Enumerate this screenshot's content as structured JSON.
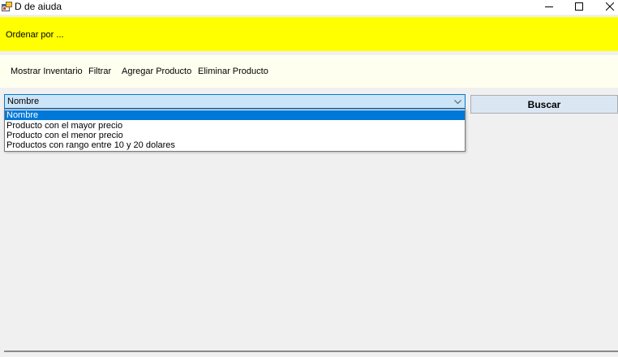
{
  "window": {
    "title": "D de aiuda",
    "icons": {
      "app": "app-window-icon",
      "minimize": "minimize-icon",
      "maximize": "maximize-icon",
      "close": "close-icon"
    }
  },
  "order_bar": {
    "label": "Ordenar por ..."
  },
  "menu": {
    "items": [
      "Mostrar Inventario",
      "Filtrar",
      "Agregar Producto",
      "Eliminar Producto"
    ]
  },
  "sort_combo": {
    "selected": "Nombre",
    "arrow_icon": "chevron-down-icon",
    "options": [
      "Nombre",
      "Producto con el mayor precio",
      "Producto con el menor precio",
      "Productos con rango entre 10 y 20 dolares"
    ],
    "highlighted_index": 0
  },
  "search_button": {
    "label": "Buscar"
  },
  "colors": {
    "order_bar": "#ffff00",
    "menu_bar": "#fffff0",
    "selection": "#0078d7",
    "combo_background": "#cce4f7",
    "button_background": "#dbe6f3"
  }
}
